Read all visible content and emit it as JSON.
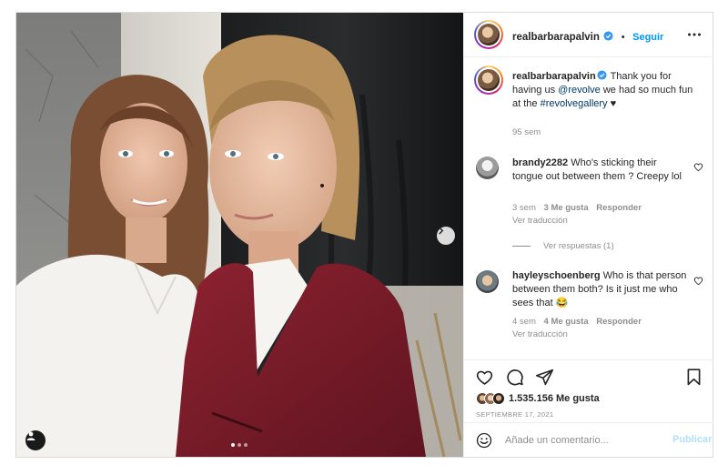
{
  "post": {
    "author": "realbarbarapalvin",
    "follow_label": "Seguir",
    "separator": "•",
    "caption": {
      "username": "realbarbarapalvin",
      "text_1": " Thank you for having us ",
      "mention": "@revolve",
      "text_2": " we had so much fun at the ",
      "hashtag": "#revolvegallery",
      "text_3": " ♥",
      "time": "95 sem"
    },
    "comments": [
      {
        "username": "brandy2282",
        "text": " Who's sticking their tongue out between them ? Creepy lol",
        "time": "3 sem",
        "likes": "3 Me gusta",
        "reply": "Responder",
        "translate": "Ver traducción",
        "view_replies": "Ver respuestas (1)"
      },
      {
        "username": "hayleyschoenberg",
        "text": " Who is that person between them both? Is it just me who sees that 😂",
        "time": "4 sem",
        "likes": "4 Me gusta",
        "reply": "Responder",
        "translate": "Ver traducción"
      }
    ],
    "likes_count": "1.535.156 Me gusta",
    "date": "SEPTIEMBRE 17, 2021",
    "comment_placeholder": "Añade un comentario...",
    "publish_label": "Publicar",
    "carousel": {
      "slides": 3,
      "active": 1
    }
  },
  "icons": [
    "more-icon",
    "heart-icon",
    "comment-icon",
    "share-icon",
    "bookmark-icon",
    "emoji-icon",
    "chevron-right-icon",
    "user-tag-icon",
    "verified-icon"
  ],
  "colors": {
    "accent": "#0095f6",
    "link": "#00376b",
    "muted": "#8e8e8e",
    "border": "#dbdbdb",
    "publish_disabled": "#b2dffc"
  }
}
